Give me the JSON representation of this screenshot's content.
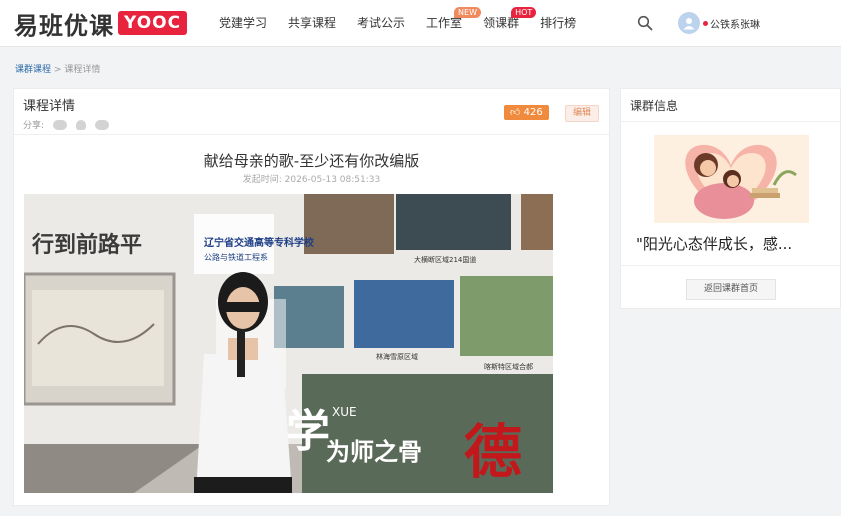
{
  "header": {
    "logo_text": "易班优课",
    "logo_badge": "YOOC",
    "nav": [
      {
        "label": "党建学习",
        "tag": ""
      },
      {
        "label": "共享课程",
        "tag": ""
      },
      {
        "label": "考试公示",
        "tag": ""
      },
      {
        "label": "工作室",
        "tag": "NEW"
      },
      {
        "label": "领课群",
        "tag": "HOT"
      },
      {
        "label": "排行榜",
        "tag": ""
      }
    ],
    "username": "公铁系张琳"
  },
  "breadcrumb": {
    "link": "课群课程",
    "separator": ">",
    "current": "课程详情"
  },
  "detail": {
    "heading": "课程详情",
    "share_label": "分享:",
    "like_count": "426",
    "edit_label": "编辑",
    "article_title": "献给母亲的歌-至少还有你改编版",
    "publish_time": "发起时间: 2026-05-13 08:51:33"
  },
  "photo_text": {
    "wall_left": "行到前路平",
    "college": "辽宁省交通高等专科学校",
    "college_sub": "公路与铁道工程系",
    "big_char": "德",
    "slogan_a": "学",
    "slogan_b": "XUE",
    "slogan_c": "为师之骨",
    "caption_1": "大横断区域214国道",
    "caption_2": "林海雪原区域",
    "caption_3": "喀斯特区域合郝"
  },
  "sidebar": {
    "title": "课群信息",
    "course_name": "\"阳光心态伴成长，感...",
    "back_button": "返回课群首页"
  },
  "colors": {
    "brand_red": "#e8233e",
    "like_orange": "#f08a3c",
    "link_blue": "#2d6ca8"
  }
}
